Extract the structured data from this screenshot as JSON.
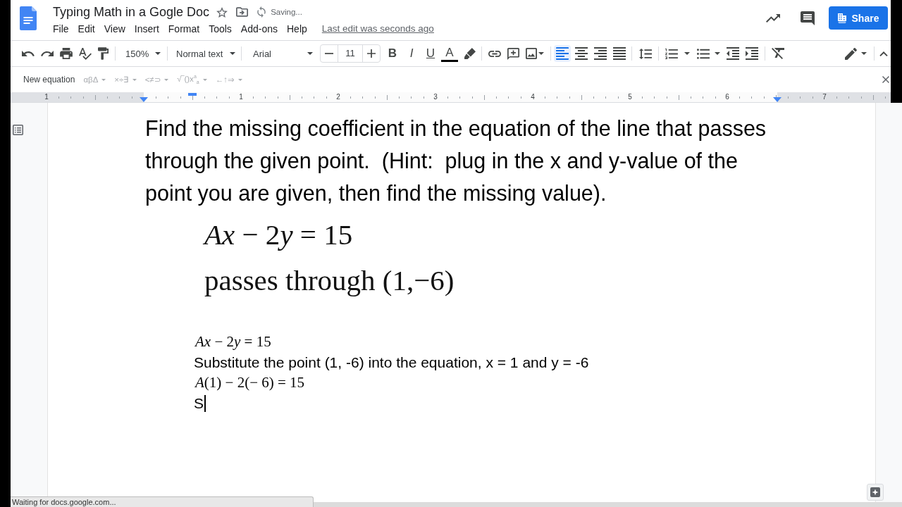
{
  "window": {
    "title": "Typing Math in a Gogle Doc",
    "save_status": "Saving..."
  },
  "menu": [
    "File",
    "Edit",
    "View",
    "Insert",
    "Format",
    "Tools",
    "Add-ons",
    "Help"
  ],
  "last_edit": "Last edit was seconds ago",
  "share": "Share",
  "toolbar": {
    "zoom": "150%",
    "paragraph_style": "Normal text",
    "font": "Arial",
    "font_size": "11",
    "format_buttons": [
      {
        "kind": "bold",
        "label": "B"
      },
      {
        "kind": "italic",
        "label": "I"
      },
      {
        "kind": "underline",
        "label": "U"
      },
      {
        "kind": "text_color",
        "label": "A"
      }
    ],
    "alignment": [
      {
        "kind": "left",
        "selected": true
      },
      {
        "kind": "center",
        "selected": false
      },
      {
        "kind": "right",
        "selected": false
      },
      {
        "kind": "justify",
        "selected": false
      }
    ]
  },
  "equation_bar": {
    "new_equation": "New equation",
    "menus": [
      {
        "label": "αβΔ",
        "disabled": true
      },
      {
        "label": "×÷∃",
        "disabled": true
      },
      {
        "label": "<≠⊃",
        "disabled": true
      },
      {
        "label": "√‾()x$^{a}$$_{a}$",
        "disabled": true
      },
      {
        "label": "←↑⇒",
        "disabled": true
      }
    ]
  },
  "ruler": {
    "labels": [
      "1",
      "1",
      "2",
      "3",
      "4",
      "5",
      "6",
      "7"
    ]
  },
  "document": {
    "paragraph": "Find the missing coefficient in the equation of the line that passes through the given point.  (Hint:  plug in the x and y-value of the point you are given, then find the missing value).",
    "image_lines": [
      {
        "kind": "equation",
        "text": "Ax − 2y = 15"
      },
      {
        "kind": "text",
        "text": "passes through (1,−6)"
      }
    ],
    "lines": [
      {
        "kind": "equation",
        "text": "Ax − 2y = 15",
        "cursor": false
      },
      {
        "kind": "text",
        "text": "Substitute the point (1, -6) into the equation, x = 1 and y = -6",
        "cursor": false
      },
      {
        "kind": "equation",
        "text": "A(1) − 2(− 6) = 15",
        "cursor": false
      },
      {
        "kind": "text",
        "text": "S",
        "cursor": true
      }
    ]
  },
  "status_bar": "Waiting for docs.google.com..."
}
